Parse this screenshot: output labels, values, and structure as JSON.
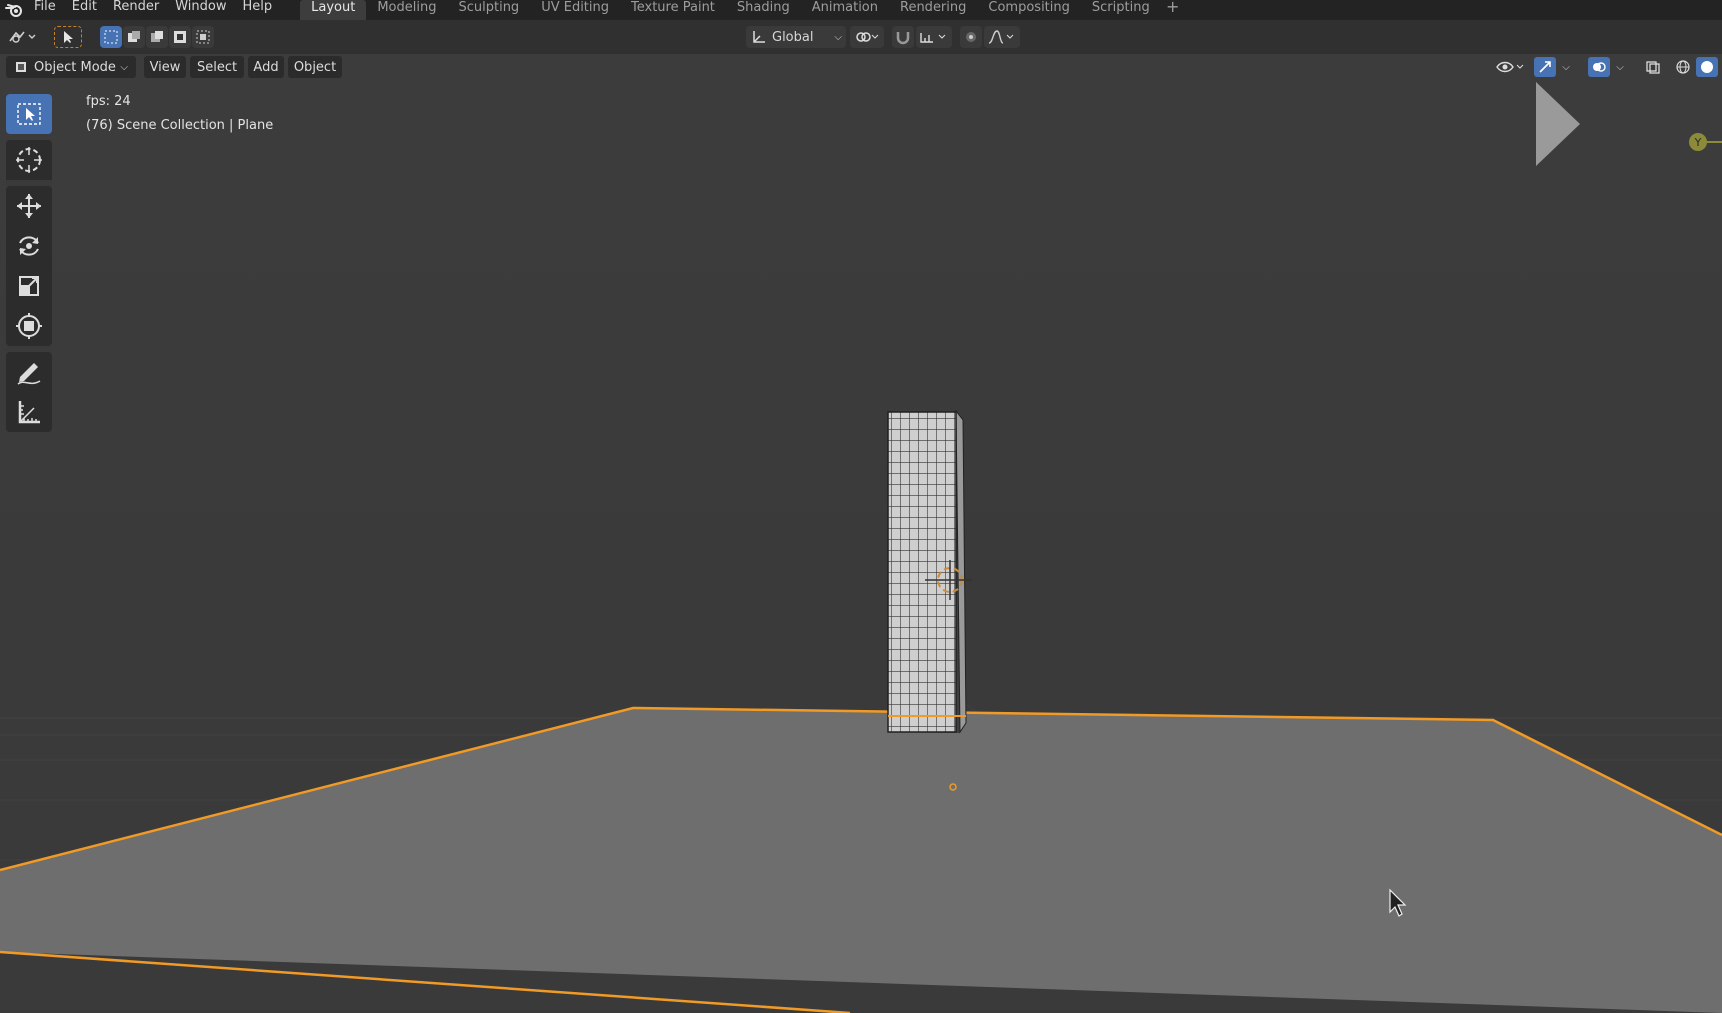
{
  "menu": {
    "items": [
      "File",
      "Edit",
      "Render",
      "Window",
      "Help"
    ]
  },
  "workspaces": {
    "tabs": [
      "Layout",
      "Modeling",
      "Sculpting",
      "UV Editing",
      "Texture Paint",
      "Shading",
      "Animation",
      "Rendering",
      "Compositing",
      "Scripting"
    ],
    "active": "Layout",
    "add_label": "+"
  },
  "tool_header": {
    "transform_orientation": "Global"
  },
  "viewport_header": {
    "mode": "Object Mode",
    "menus": [
      "View",
      "Select",
      "Add",
      "Object"
    ]
  },
  "overlay": {
    "fps": "fps: 24",
    "collection": "(76) Scene Collection | Plane"
  },
  "gizmo": {
    "y_axis_label": "Y"
  },
  "colors": {
    "accent_blue": "#4772b3",
    "selection_orange": "#f5a623",
    "viewport_bg": "#3a3a3a",
    "plane_gray": "#6f6f6f"
  },
  "toolbar": {
    "tools": [
      "select-box",
      "cursor",
      "move",
      "rotate",
      "scale",
      "transform",
      "annotate",
      "measure"
    ],
    "active": "select-box"
  }
}
